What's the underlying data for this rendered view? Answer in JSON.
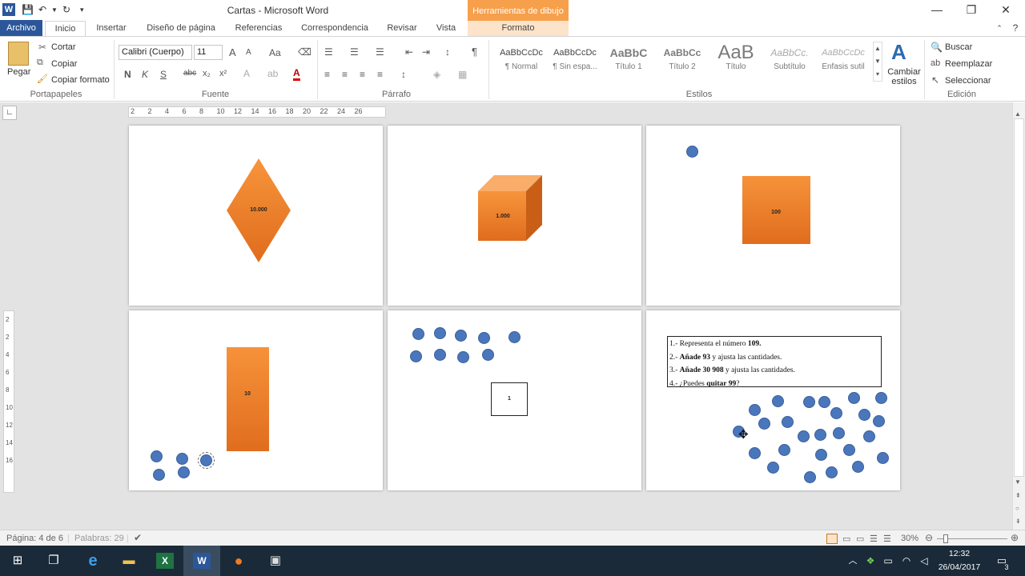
{
  "window": {
    "title": "Cartas - Microsoft Word",
    "contextual_header": "Herramientas de dibujo"
  },
  "tabs": [
    "Archivo",
    "Inicio",
    "Insertar",
    "Diseño de página",
    "Referencias",
    "Correspondencia",
    "Revisar",
    "Vista",
    "Formato"
  ],
  "clipboard": {
    "paste": "Pegar",
    "cut": "Cortar",
    "copy": "Copiar",
    "format_painter": "Copiar formato",
    "label": "Portapapeles"
  },
  "font": {
    "name": "Calibri (Cuerpo)",
    "size": "11",
    "label": "Fuente",
    "bold": "N",
    "italic": "K",
    "underline": "S",
    "strike": "abc",
    "sub": "x₂",
    "sup": "x²",
    "grow": "A",
    "shrink": "A",
    "case": "Aa"
  },
  "paragraph": {
    "label": "Párrafo"
  },
  "styles": {
    "label": "Estilos",
    "change": "Cambiar estilos",
    "items": [
      {
        "preview": "AaBbCcDc",
        "name": "¶ Normal"
      },
      {
        "preview": "AaBbCcDc",
        "name": "¶ Sin espa..."
      },
      {
        "preview": "AaBbC",
        "name": "Título 1"
      },
      {
        "preview": "AaBbCc",
        "name": "Título 2"
      },
      {
        "preview": "AaB",
        "name": "Título"
      },
      {
        "preview": "AaBbCc.",
        "name": "Subtítulo"
      },
      {
        "preview": "AaBbCcDc",
        "name": "Énfasis sutil"
      }
    ]
  },
  "editing": {
    "find": "Buscar",
    "replace": "Reemplazar",
    "select": "Seleccionar",
    "label": "Edición"
  },
  "ruler": {
    "ticks": [
      "2",
      "2",
      "4",
      "6",
      "8",
      "10",
      "12",
      "14",
      "16",
      "18",
      "20",
      "22",
      "24",
      "26"
    ],
    "vticks": [
      "2",
      "2",
      "4",
      "6",
      "8",
      "10",
      "12",
      "14",
      "16"
    ]
  },
  "pages": {
    "p1": {
      "label": "10.000"
    },
    "p2": {
      "label": "1.000"
    },
    "p3": {
      "label": "100"
    },
    "p4": {
      "label": "10"
    },
    "p5": {
      "label": "1"
    },
    "p6": {
      "lines": [
        {
          "n": "1.-",
          "a": " Representa el número ",
          "b": "109."
        },
        {
          "n": "2.-",
          "a": " ",
          "b": "Añade 93",
          "c": " y ajusta las cantidades."
        },
        {
          "n": "3.-",
          "a": " ",
          "b": "Añade 30 908",
          "c": " y ajusta las cantidades."
        },
        {
          "n": "4.-",
          "a": " ¿Puedes ",
          "b": "quitar 99",
          "c": "?"
        }
      ]
    }
  },
  "status": {
    "page": "Página: 4 de 6",
    "words": "Palabras: 29",
    "zoom": "30%"
  },
  "taskbar": {
    "time": "12:32",
    "date": "26/04/2017",
    "notifications": "3"
  }
}
